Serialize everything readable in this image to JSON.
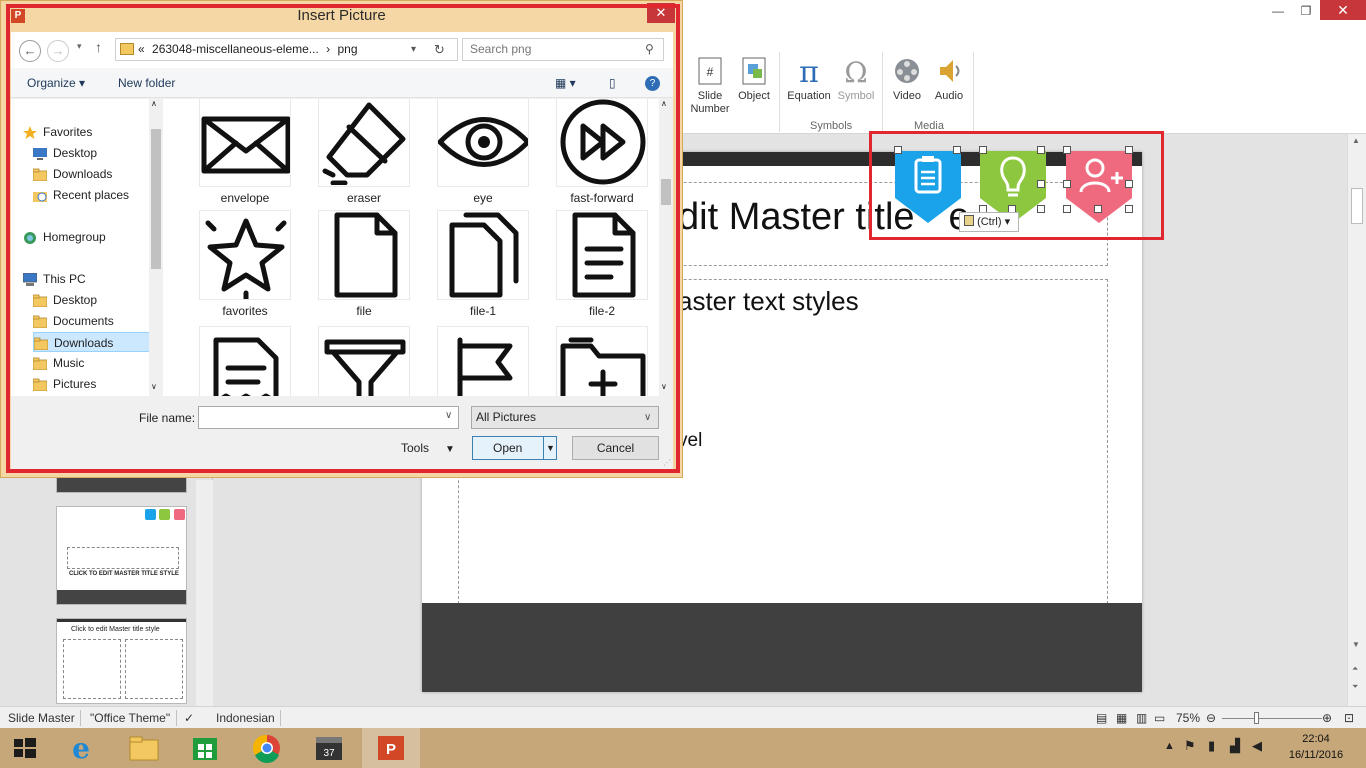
{
  "ribbon": {
    "slide_number": "Slide\nNumber",
    "object": "Object",
    "equation": "Equation",
    "symbol": "Symbol",
    "video": "Video",
    "audio": "Audio",
    "group_symbols": "Symbols",
    "group_media": "Media"
  },
  "slide": {
    "title_fragment": "dit Master title",
    "title_fragment2": "e",
    "body_line1": "aster text styles",
    "body_line4": "l",
    "body_line5": "vel"
  },
  "paste_tag": "(Ctrl)",
  "thumbnails": {
    "t2_title": "CLICK TO EDIT MASTER  TITLE STYLE",
    "t3_title": "Click to edit Master title style"
  },
  "statusbar": {
    "view": "Slide Master",
    "theme": "\"Office Theme\"",
    "language": "Indonesian",
    "zoom": "75%"
  },
  "taskbar": {
    "time": "22:04",
    "date": "16/11/2016"
  },
  "dialog": {
    "title": "Insert Picture",
    "address_prefix": "«",
    "address_folder": "263048-miscellaneous-eleme...",
    "address_sep": "›",
    "address_sub": "png",
    "search_placeholder": "Search png",
    "organize": "Organize",
    "new_folder": "New folder",
    "nav": [
      {
        "label": "Favorites",
        "icon": "star-icon"
      },
      {
        "label": "Desktop",
        "icon": "desktop-icon"
      },
      {
        "label": "Downloads",
        "icon": "folder-icon"
      },
      {
        "label": "Recent places",
        "icon": "recent-places-icon"
      },
      {
        "label": "Homegroup",
        "icon": "homegroup-icon"
      },
      {
        "label": "This PC",
        "icon": "computer-icon"
      },
      {
        "label": "Desktop",
        "icon": "folder-icon"
      },
      {
        "label": "Documents",
        "icon": "folder-icon"
      },
      {
        "label": "Downloads",
        "icon": "folder-icon"
      },
      {
        "label": "Music",
        "icon": "folder-icon"
      },
      {
        "label": "Pictures",
        "icon": "folder-icon"
      }
    ],
    "files": [
      {
        "name": "envelope",
        "icon": "envelope-icon"
      },
      {
        "name": "eraser",
        "icon": "eraser-icon"
      },
      {
        "name": "eye",
        "icon": "eye-icon"
      },
      {
        "name": "fast-forward",
        "icon": "fast-forward-icon"
      },
      {
        "name": "favorites",
        "icon": "star-icon"
      },
      {
        "name": "file",
        "icon": "file-icon"
      },
      {
        "name": "file-1",
        "icon": "file-copy-icon"
      },
      {
        "name": "file-2",
        "icon": "file-text-icon"
      },
      {
        "name": "",
        "icon": "receipt-icon"
      },
      {
        "name": "",
        "icon": "funnel-icon"
      },
      {
        "name": "",
        "icon": "flag-icon"
      },
      {
        "name": "",
        "icon": "folder-add-icon"
      }
    ],
    "file_name_label": "File name:",
    "file_name_value": "",
    "filter": "All Pictures",
    "tools": "Tools",
    "open": "Open",
    "cancel": "Cancel"
  },
  "colors": {
    "accent_red": "#e0262e",
    "icon_blue": "#1aa3e8",
    "icon_green": "#8dc63f",
    "icon_pink": "#f06a7f",
    "dialog_frame": "#f5d7a6",
    "taskbar": "#c6a77a"
  }
}
